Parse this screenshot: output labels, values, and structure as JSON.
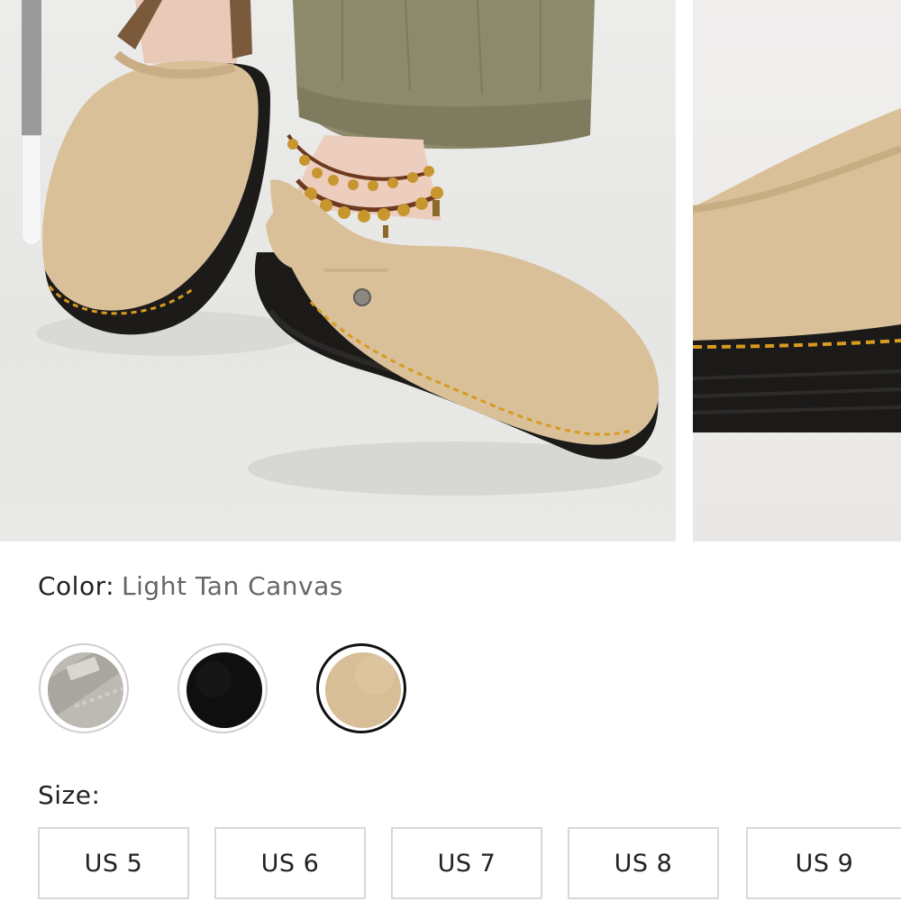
{
  "gallery": {
    "images": [
      {
        "icon": "product-photo-clog-worn"
      },
      {
        "icon": "product-photo-clog-closeup"
      }
    ],
    "colors": {
      "suede": "#d9c099",
      "sole": "#1b1a19",
      "stitch": "#d89a1f",
      "trouser": "#8d8a6c"
    }
  },
  "color": {
    "label": "Color:",
    "value": "Light Tan Canvas",
    "swatches": [
      {
        "icon": "grey-canvas-swatch",
        "color": "#b7b4ad",
        "selected": false
      },
      {
        "icon": "black-suede-swatch",
        "color": "#101010",
        "selected": false
      },
      {
        "icon": "tan-suede-swatch",
        "color": "#d7be96",
        "selected": true
      }
    ]
  },
  "size": {
    "label": "Size:",
    "options": [
      "US 5",
      "US 6",
      "US 7",
      "US 8",
      "US 9"
    ]
  }
}
